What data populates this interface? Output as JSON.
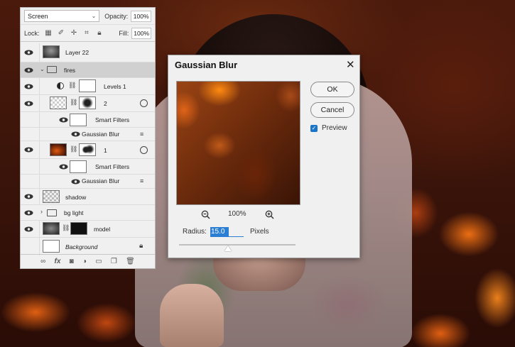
{
  "layers_panel": {
    "blend_mode": "Screen",
    "opacity_label": "Opacity:",
    "opacity_value": "100%",
    "lock_label": "Lock:",
    "fill_label": "Fill:",
    "fill_value": "100%",
    "layers": [
      {
        "name": "Layer 22",
        "italic": false
      },
      {
        "name": "fires",
        "italic": false,
        "group": true,
        "selected": true
      },
      {
        "name": "Levels 1",
        "italic": false
      },
      {
        "name": "2",
        "italic": false
      },
      {
        "name": "Smart Filters",
        "italic": false
      },
      {
        "name": "Gaussian Blur",
        "italic": false
      },
      {
        "name": "1",
        "italic": false
      },
      {
        "name": "Smart Filters",
        "italic": false
      },
      {
        "name": "Gaussian Blur",
        "italic": false
      },
      {
        "name": "shadow",
        "italic": false
      },
      {
        "name": "bg light",
        "italic": false,
        "group": true
      },
      {
        "name": "model",
        "italic": false
      },
      {
        "name": "Background",
        "italic": true
      }
    ]
  },
  "dialog": {
    "title": "Gaussian Blur",
    "ok_label": "OK",
    "cancel_label": "Cancel",
    "preview_label": "Preview",
    "preview_checked": true,
    "zoom_value": "100%",
    "radius_label": "Radius:",
    "radius_value": "15.0",
    "unit_label": "Pixels"
  },
  "colors": {
    "accent": "#2a7fd4",
    "panel_bg": "#f0f0f0",
    "selected_row": "#d0d0d0"
  }
}
